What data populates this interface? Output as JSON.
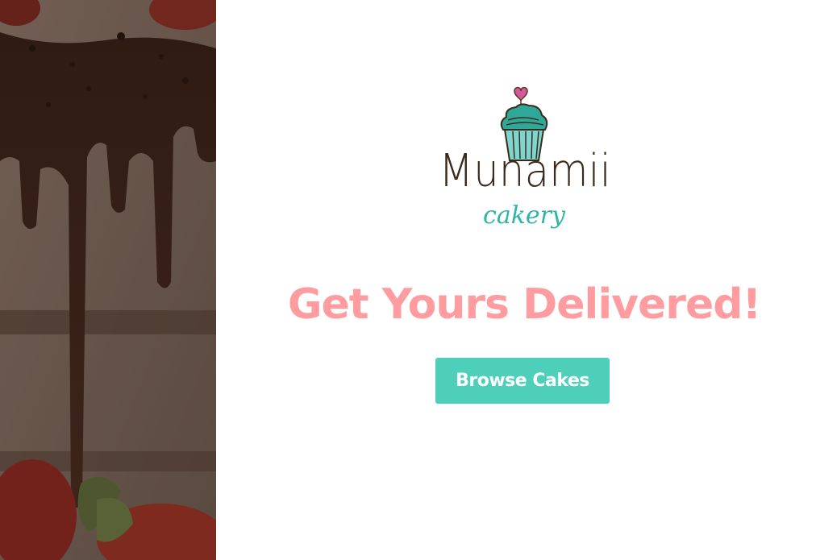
{
  "hero": {
    "image_description_icon": "chocolate-drip-cake-image"
  },
  "brand": {
    "name": "Munamii",
    "tagline": "cakery",
    "logo_icon": "cupcake-icon"
  },
  "main": {
    "headline": "Get Yours Delivered!",
    "cta_label": "Browse Cakes"
  },
  "colors": {
    "headline": "#ff9c9f",
    "button": "#4ecfb9",
    "brand_text": "#3b2a1b",
    "tagline": "#2fb5a5"
  }
}
